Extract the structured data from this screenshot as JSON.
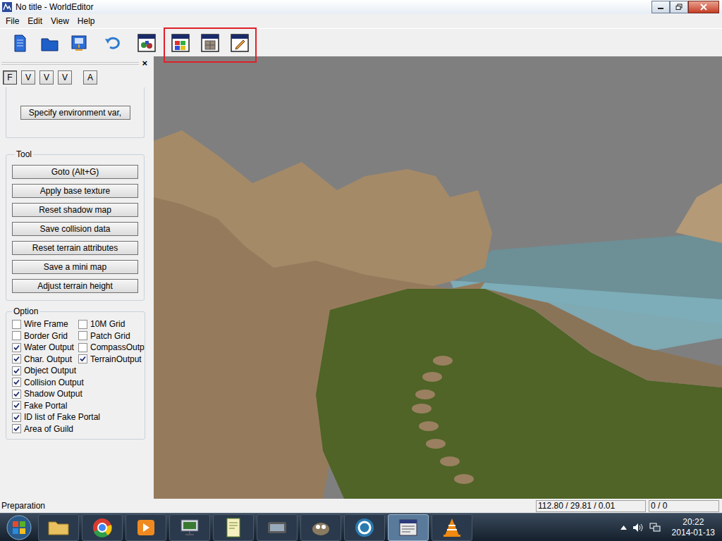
{
  "window": {
    "title": "No title - WorldEditor",
    "controls": [
      "minimize",
      "maximize",
      "close"
    ]
  },
  "menu": [
    "File",
    "Edit",
    "View",
    "Help"
  ],
  "toolbar": [
    {
      "highlighted": false,
      "buttons": [
        "new",
        "open",
        "save"
      ]
    },
    {
      "highlighted": false,
      "buttons": [
        "undo"
      ]
    },
    {
      "highlighted": false,
      "buttons": [
        "view"
      ]
    },
    {
      "highlighted": true,
      "buttons": [
        "palette",
        "texture",
        "brush"
      ]
    }
  ],
  "panel": {
    "close": "×",
    "tabs": [
      {
        "label": "F",
        "selected": true
      },
      {
        "label": "V",
        "selected": false
      },
      {
        "label": "V",
        "selected": false
      },
      {
        "label": "V",
        "selected": false
      },
      {
        "label": "A",
        "selected": false
      }
    ],
    "environment_button": "Specify environment var,",
    "tool": {
      "title": "Tool",
      "buttons": [
        "Goto (Alt+G)",
        "Apply base texture",
        "Reset shadow map",
        "Save collision data",
        "Reset terrain attributes",
        "Save a mini map",
        "Adjust terrain height"
      ]
    },
    "option": {
      "title": "Option",
      "rows": [
        [
          {
            "label": "Wire Frame",
            "checked": false
          },
          {
            "label": "10M Grid",
            "checked": false
          }
        ],
        [
          {
            "label": "Border Grid",
            "checked": false
          },
          {
            "label": "Patch Grid",
            "checked": false
          }
        ],
        [
          {
            "label": "Water Output",
            "checked": true
          },
          {
            "label": "CompassOutp",
            "checked": false
          }
        ],
        [
          {
            "label": "Char. Output",
            "checked": true
          },
          {
            "label": "TerrainOutput",
            "checked": true
          }
        ],
        [
          {
            "label": "Object Output",
            "checked": true
          }
        ],
        [
          {
            "label": "Collision Output",
            "checked": true
          }
        ],
        [
          {
            "label": "Shadow Output",
            "checked": true
          }
        ],
        [
          {
            "label": "Fake Portal",
            "checked": true
          }
        ],
        [
          {
            "label": "ID list of Fake Portal",
            "checked": true
          }
        ],
        [
          {
            "label": "Area of Guild",
            "checked": true
          }
        ]
      ]
    }
  },
  "status_bar": {
    "message": "Preparation",
    "coordinates": "112.80 / 29.81 / 0.01",
    "count": "0 / 0"
  },
  "taskbar": {
    "apps": [
      {
        "kind": "folder",
        "active": false
      },
      {
        "kind": "chrome",
        "active": false
      },
      {
        "kind": "media",
        "active": false
      },
      {
        "kind": "computer",
        "active": false
      },
      {
        "kind": "notepad",
        "active": false
      },
      {
        "kind": "game",
        "active": false
      },
      {
        "kind": "gimp",
        "active": false
      },
      {
        "kind": "max",
        "active": false
      },
      {
        "kind": "editor",
        "active": true
      },
      {
        "kind": "vlc",
        "active": false
      }
    ],
    "time": "20:22",
    "date": "2014-01-13"
  }
}
